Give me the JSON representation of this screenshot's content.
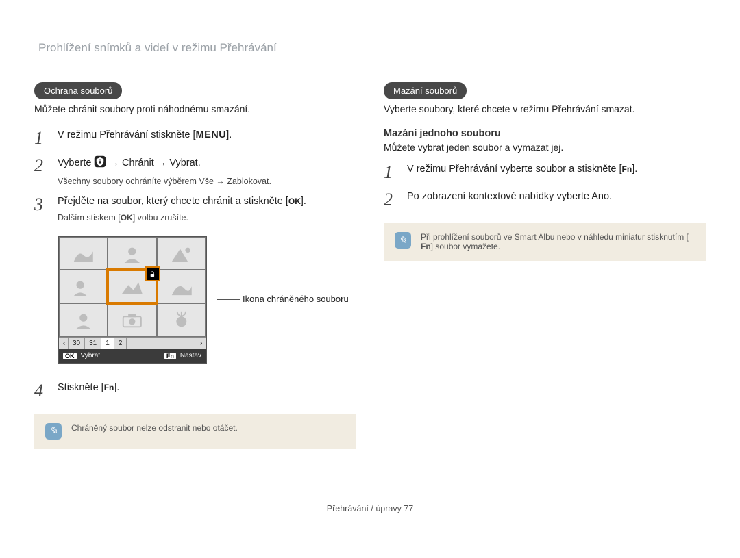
{
  "header": "Prohlížení snímků a videí v režimu Přehrávání",
  "left": {
    "pill": "Ochrana souborů",
    "lead": "Můžete chránit soubory proti náhodnému smazání.",
    "step1": {
      "text_a": "V režimu Přehrávání stiskněte [",
      "text_b": "]."
    },
    "menu_label": "MENU",
    "step2": {
      "text_a": "Vyberte ",
      "text_b": " → Chránit → Vybrat.",
      "sub": "Všechny soubory ochráníte výběrem Vše → Zablokovat."
    },
    "step3": {
      "text_a": "Přejděte na soubor, který chcete chránit a stiskněte [",
      "text_b": "].",
      "sub_a": "Dalším stiskem [",
      "sub_b": "] volbu zrušíte."
    },
    "ok_label": "OK",
    "camera": {
      "caption": "Ikona chráněného souboru",
      "strip": {
        "d30": "30",
        "d31": "31",
        "d1": "1",
        "d2": "2"
      },
      "bar": {
        "ok": "OK",
        "vybrat": "Vybrat",
        "fn": "Fn",
        "nastav": "Nastav"
      }
    },
    "step4": {
      "text_a": "Stiskněte [",
      "text_b": "]."
    },
    "fn_label": "Fn",
    "note": "Chráněný soubor nelze odstranit nebo otáčet."
  },
  "right": {
    "pill": "Mazání souborů",
    "lead": "Vyberte soubory, které chcete v režimu Přehrávání smazat.",
    "sub_heading": "Mazání jednoho souboru",
    "sub_lead": "Můžete vybrat jeden soubor a vymazat jej.",
    "step1": {
      "text_a": "V režimu Přehrávání vyberte soubor a stiskněte [",
      "text_b": "]."
    },
    "step2": {
      "text": "Po zobrazení kontextové nabídky vyberte Ano."
    },
    "note_a": "Při prohlížení souborů ve Smart Albu nebo v náhledu miniatur stisknutím [",
    "note_b": "] soubor vymažete."
  },
  "footer": {
    "text": "Přehrávání / úpravy ",
    "page": "77"
  }
}
